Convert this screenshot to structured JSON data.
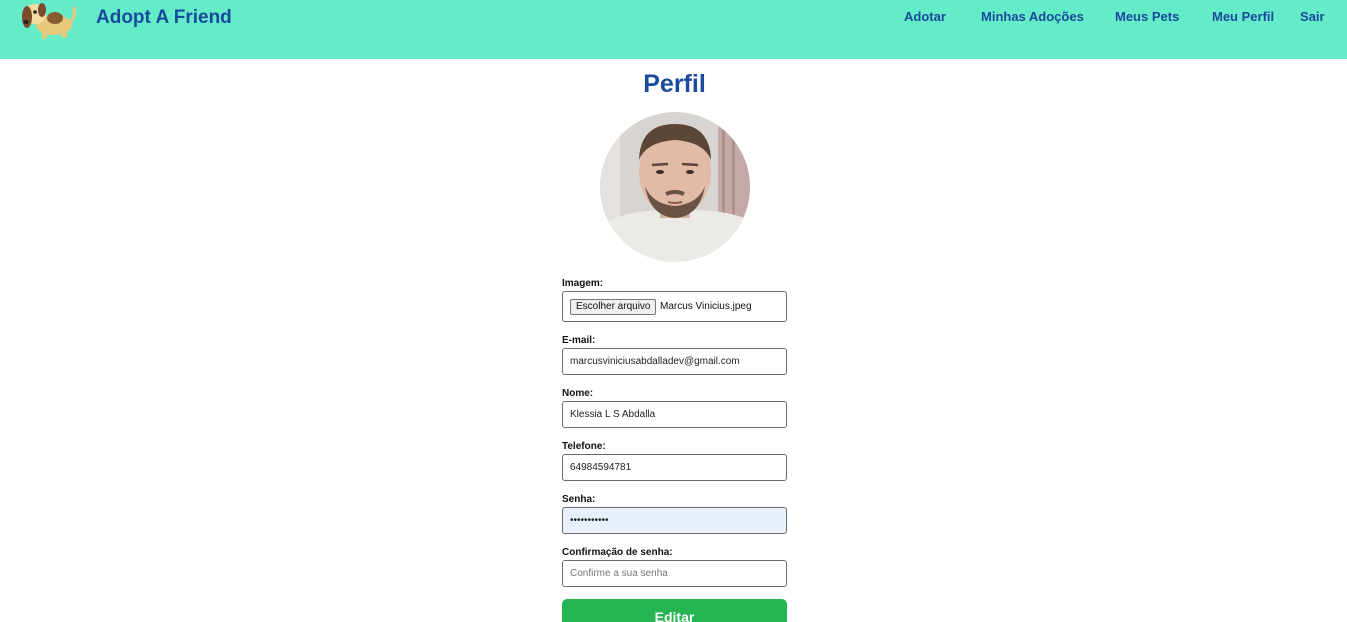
{
  "header": {
    "brand": "Adopt A Friend",
    "logo_icon": "dog-logo-icon",
    "nav": [
      "Adotar",
      "Minhas Adoções",
      "Meus Pets",
      "Meu Perfil",
      "Sair"
    ]
  },
  "page": {
    "title": "Perfil",
    "avatar_icon": "profile-photo"
  },
  "form": {
    "image": {
      "label": "Imagem:",
      "button_label": "Escolher arquivo",
      "file_name": "Marcus Vinicius.jpeg"
    },
    "email": {
      "label": "E-mail:",
      "value": "marcusviniciusabdalladev@gmail.com"
    },
    "name": {
      "label": "Nome:",
      "value": "Klessia L S Abdalla"
    },
    "phone": {
      "label": "Telefone:",
      "value": "64984594781"
    },
    "password": {
      "label": "Senha:",
      "value": "marcus12345"
    },
    "confirm": {
      "label": "Confirmação de senha:",
      "value": "",
      "placeholder": "Confirme a sua senha"
    },
    "submit_label": "Editar"
  },
  "colors": {
    "navbar": "#64ecc9",
    "brand_text": "#1a4a9c",
    "submit": "#26b553",
    "autofill": "#e8f0fe"
  }
}
